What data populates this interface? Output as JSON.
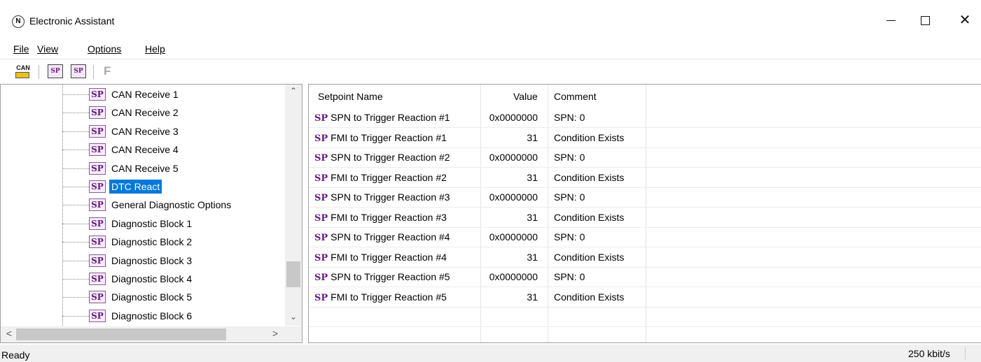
{
  "window": {
    "title": "Electronic Assistant",
    "minimize_label": "Minimize",
    "maximize_label": "Maximize",
    "close_glyph": "✕"
  },
  "menu": {
    "items": [
      {
        "label": "File"
      },
      {
        "label": "View"
      },
      {
        "label": "Options"
      },
      {
        "label": "Help"
      }
    ]
  },
  "toolbar": {
    "can_label": "CAN",
    "sp_label": "SP",
    "f_label": "F",
    "icons": [
      "can-connect-icon",
      "setpoint-open-icon",
      "setpoint-save-icon",
      "flash-icon"
    ]
  },
  "tree": {
    "icon_text": "SP",
    "items": [
      {
        "label": "CAN Receive 1"
      },
      {
        "label": "CAN Receive 2"
      },
      {
        "label": "CAN Receive 3"
      },
      {
        "label": "CAN Receive 4"
      },
      {
        "label": "CAN Receive 5"
      },
      {
        "label": "DTC React",
        "selected": true
      },
      {
        "label": "General Diagnostic Options"
      },
      {
        "label": "Diagnostic Block 1"
      },
      {
        "label": "Diagnostic Block 2"
      },
      {
        "label": "Diagnostic Block 3"
      },
      {
        "label": "Diagnostic Block 4"
      },
      {
        "label": "Diagnostic Block 5"
      },
      {
        "label": "Diagnostic Block 6"
      }
    ],
    "scroll_up": "⌃",
    "scroll_down": "⌄",
    "scroll_left": "<",
    "scroll_right": ">"
  },
  "list": {
    "columns": [
      "Setpoint Name",
      "Value",
      "Comment"
    ],
    "sp_mark": "SP",
    "rows": [
      {
        "name": "SPN to Trigger Reaction #1",
        "value": "0x0000000",
        "comment": "SPN: 0"
      },
      {
        "name": "FMI to Trigger Reaction #1",
        "value": "31",
        "comment": "Condition Exists"
      },
      {
        "name": "SPN to Trigger Reaction #2",
        "value": "0x0000000",
        "comment": "SPN: 0"
      },
      {
        "name": "FMI to Trigger Reaction #2",
        "value": "31",
        "comment": "Condition Exists"
      },
      {
        "name": "SPN to Trigger Reaction #3",
        "value": "0x0000000",
        "comment": "SPN: 0"
      },
      {
        "name": "FMI to Trigger Reaction #3",
        "value": "31",
        "comment": "Condition Exists"
      },
      {
        "name": "SPN to Trigger Reaction #4",
        "value": "0x0000000",
        "comment": "SPN: 0"
      },
      {
        "name": "FMI to Trigger Reaction #4",
        "value": "31",
        "comment": "Condition Exists"
      },
      {
        "name": "SPN to Trigger Reaction #5",
        "value": "0x0000000",
        "comment": "SPN: 0"
      },
      {
        "name": "FMI to Trigger Reaction #5",
        "value": "31",
        "comment": "Condition Exists"
      }
    ]
  },
  "status": {
    "left": "Ready",
    "right": "250 kbit/s"
  },
  "colors": {
    "selection": "#0078d7",
    "sp_icon": "#6b1a86"
  }
}
